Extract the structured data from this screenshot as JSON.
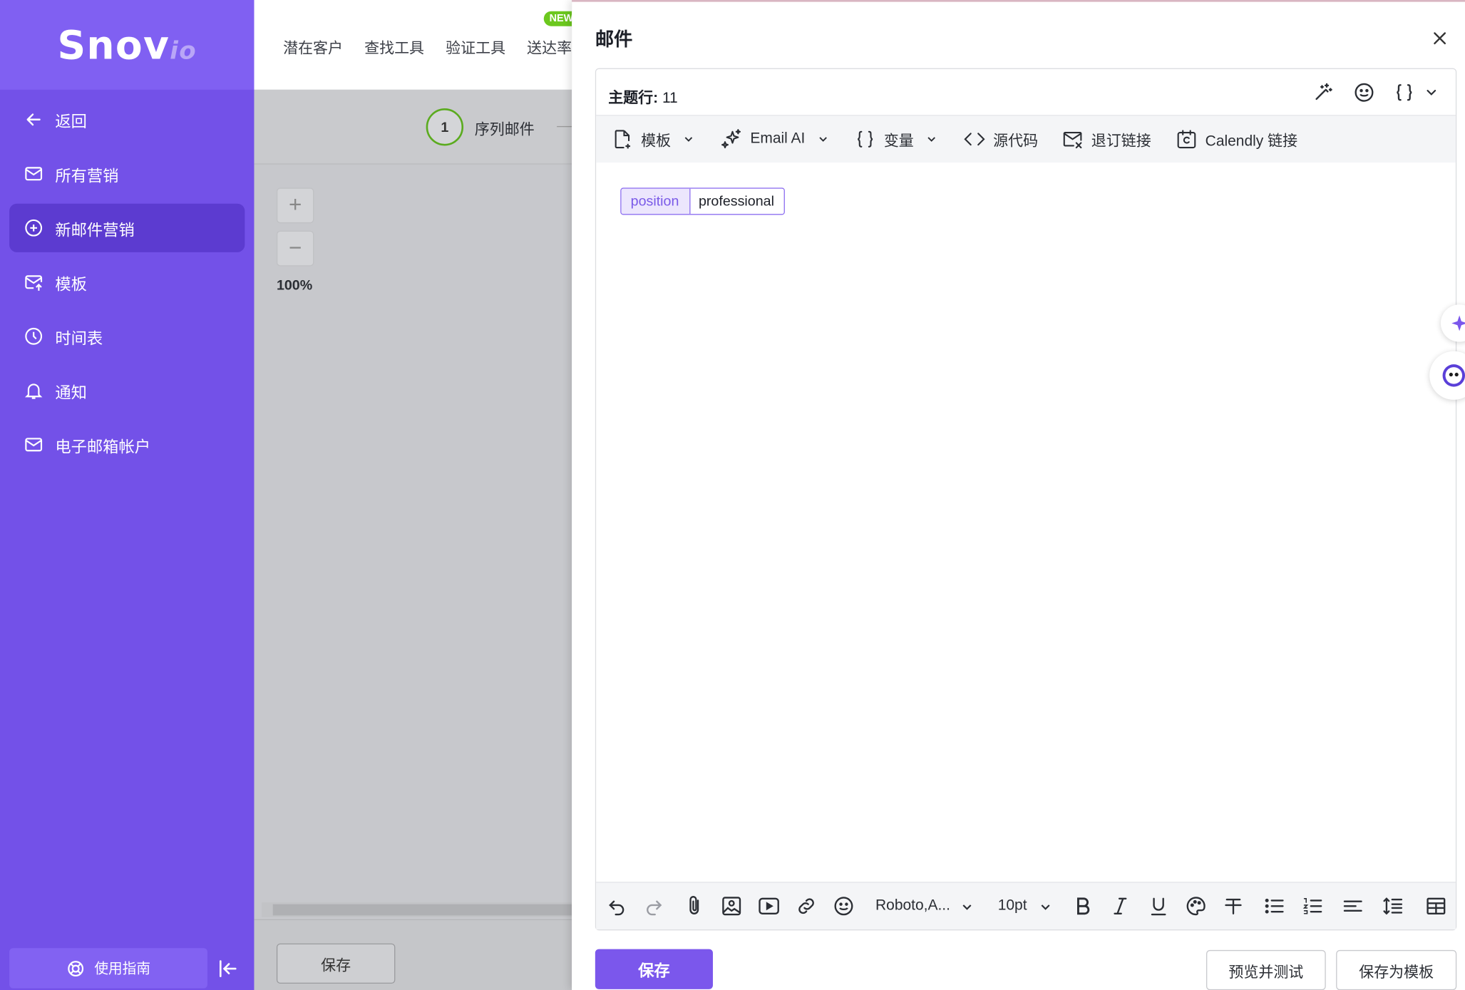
{
  "brand": {
    "logo_main": "Snov",
    "logo_suffix": "io"
  },
  "sidebar": {
    "items": [
      {
        "label": "返回",
        "icon": "arrow-left-icon"
      },
      {
        "label": "所有营销",
        "icon": "mail-icon"
      },
      {
        "label": "新邮件营销",
        "icon": "plus-circle-icon",
        "active": true
      },
      {
        "label": "模板",
        "icon": "mail-template-icon"
      },
      {
        "label": "时间表",
        "icon": "clock-icon"
      },
      {
        "label": "通知",
        "icon": "bell-icon"
      },
      {
        "label": "电子邮箱帐户",
        "icon": "mail-icon"
      }
    ],
    "guide_label": "使用指南"
  },
  "topnav": {
    "items": [
      "潜在客户",
      "查找工具",
      "验证工具",
      "送达率"
    ],
    "new_badge": "NEW"
  },
  "steps": {
    "step_number": "1",
    "step_label": "序列邮件"
  },
  "zoom": {
    "plus": "+",
    "minus": "−",
    "level": "100%"
  },
  "background_save": "保存",
  "panel": {
    "title": "邮件",
    "subject_label": "主题行:",
    "subject_value": " 11",
    "toolbar": {
      "template": "模板",
      "email_ai": "Email AI",
      "variables": "变量",
      "source_code": "源代码",
      "unsubscribe": "退订链接",
      "calendly": "Calendly 链接"
    },
    "tag": {
      "variable": "position",
      "value": "professional"
    },
    "format_bar": {
      "font": "Roboto,A...",
      "size": "10pt"
    },
    "buttons": {
      "save": "保存",
      "preview": "预览并测试",
      "save_template": "保存为模板"
    }
  },
  "colors": {
    "accent": "#7b57ec",
    "sidebar": "#7351e8",
    "success": "#6cc81e"
  }
}
